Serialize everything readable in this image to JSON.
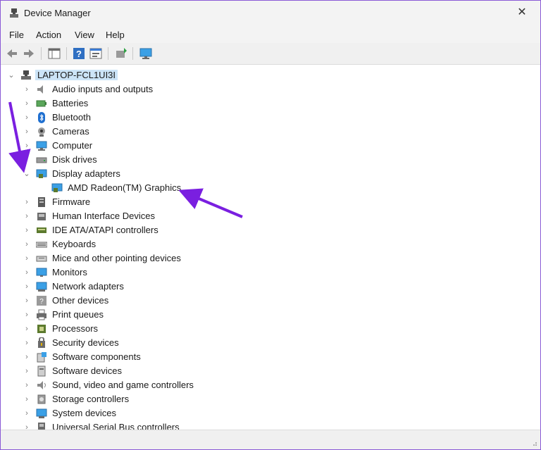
{
  "window": {
    "title": "Device Manager",
    "close_glyph": "✕"
  },
  "menu": [
    "File",
    "Action",
    "View",
    "Help"
  ],
  "toolbar": [
    "back-icon",
    "forward-icon",
    "properties-grid-icon",
    "help-icon",
    "properties-icon",
    "update-driver-icon",
    "monitor-icon"
  ],
  "tree": {
    "root": "LAPTOP-FCL1UI3I",
    "categories": [
      {
        "label": "Audio inputs and outputs",
        "icon": "speaker-icon",
        "expanded": false
      },
      {
        "label": "Batteries",
        "icon": "battery-icon",
        "expanded": false
      },
      {
        "label": "Bluetooth",
        "icon": "bluetooth-icon",
        "expanded": false
      },
      {
        "label": "Cameras",
        "icon": "camera-icon",
        "expanded": false
      },
      {
        "label": "Computer",
        "icon": "computer-icon",
        "expanded": false
      },
      {
        "label": "Disk drives",
        "icon": "disk-drive-icon",
        "expanded": false
      },
      {
        "label": "Display adapters",
        "icon": "display-adapter-icon",
        "expanded": true,
        "children": [
          "AMD Radeon(TM) Graphics"
        ]
      },
      {
        "label": "Firmware",
        "icon": "firmware-icon",
        "expanded": false
      },
      {
        "label": "Human Interface Devices",
        "icon": "hid-icon",
        "expanded": false
      },
      {
        "label": "IDE ATA/ATAPI controllers",
        "icon": "ide-controller-icon",
        "expanded": false
      },
      {
        "label": "Keyboards",
        "icon": "keyboard-icon",
        "expanded": false
      },
      {
        "label": "Mice and other pointing devices",
        "icon": "mouse-icon",
        "expanded": false
      },
      {
        "label": "Monitors",
        "icon": "monitor-icon",
        "expanded": false
      },
      {
        "label": "Network adapters",
        "icon": "network-icon",
        "expanded": false
      },
      {
        "label": "Other devices",
        "icon": "unknown-device-icon",
        "expanded": false
      },
      {
        "label": "Print queues",
        "icon": "printer-icon",
        "expanded": false
      },
      {
        "label": "Processors",
        "icon": "processor-icon",
        "expanded": false
      },
      {
        "label": "Security devices",
        "icon": "security-icon",
        "expanded": false
      },
      {
        "label": "Software components",
        "icon": "software-component-icon",
        "expanded": false
      },
      {
        "label": "Software devices",
        "icon": "software-device-icon",
        "expanded": false
      },
      {
        "label": "Sound, video and game controllers",
        "icon": "sound-icon",
        "expanded": false
      },
      {
        "label": "Storage controllers",
        "icon": "storage-icon",
        "expanded": false
      },
      {
        "label": "System devices",
        "icon": "system-device-icon",
        "expanded": false
      },
      {
        "label": "Universal Serial Bus controllers",
        "icon": "usb-icon",
        "expanded": false
      }
    ]
  },
  "colors": {
    "accent": "#7a1fe0",
    "selection": "#cce4f7",
    "window_border": "#8a5ad6"
  }
}
